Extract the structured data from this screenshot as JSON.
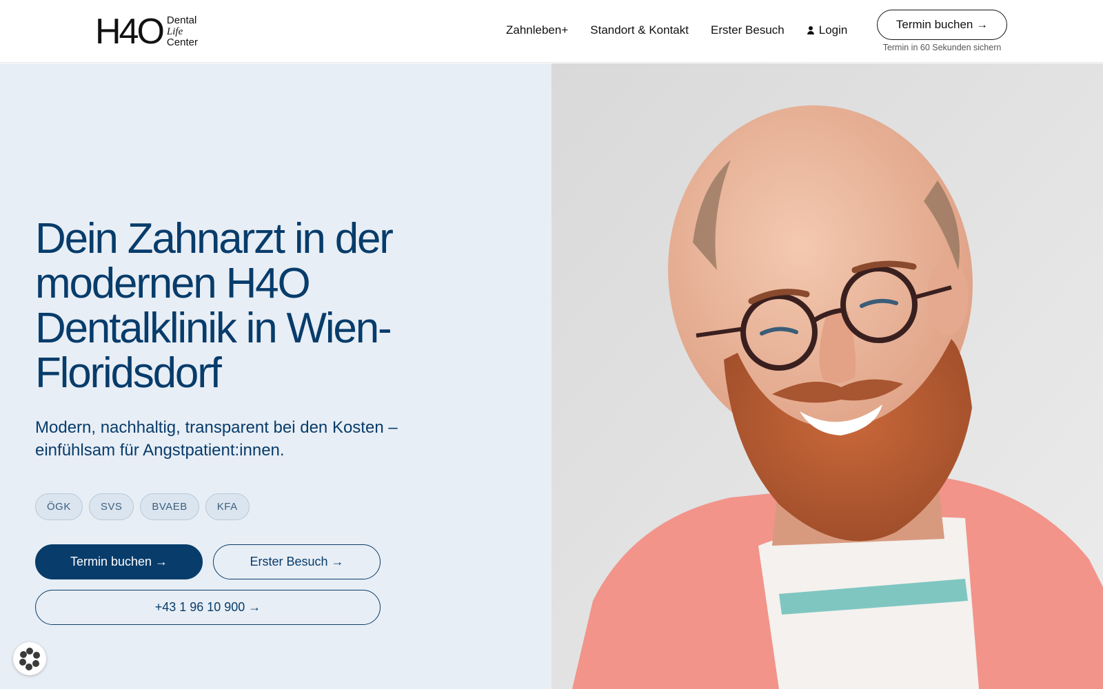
{
  "header": {
    "logo_mark": "H4O",
    "logo_words": [
      "Dental",
      "Life",
      "Center"
    ],
    "nav": [
      {
        "label": "Zahnleben+"
      },
      {
        "label": "Standort & Kontakt"
      },
      {
        "label": "Erster Besuch"
      },
      {
        "label": "Login",
        "icon": "user-icon"
      }
    ],
    "cta_label": "Termin buchen →",
    "cta_sub": "Termin in 60 Sekunden sichern"
  },
  "hero": {
    "title": "Dein Zahnarzt in der modernen H4O Dentalklinik in Wien-Floridsdorf",
    "subtitle": "Modern, nachhaltig, transparent bei den Kosten – einfühlsam für Angstpatient:innen.",
    "insurers": [
      "ÖGK",
      "SVS",
      "BVAEB",
      "KFA"
    ],
    "primary_button": "Termin buchen →",
    "secondary_button": "Erster Besuch →",
    "phone_button": "+43 1 96 10 900 →",
    "image": "portrait-photo",
    "cookie_icon": "cookie-settings-icon"
  },
  "colors": {
    "accent": "#073c6b",
    "hero_bg": "#e8eef5",
    "chip_bg": "#dae5ef",
    "shirt": "#f2948a"
  }
}
